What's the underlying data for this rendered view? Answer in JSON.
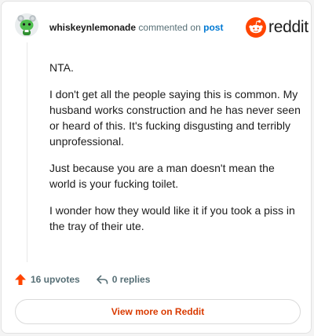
{
  "header": {
    "username": "whiskeynlemonade",
    "action_text": "commented on",
    "post_link": "post"
  },
  "brand": {
    "logo_text": "reddit",
    "accent_color": "#ff4500"
  },
  "comment": {
    "paragraphs": [
      "NTA.",
      "I don't get all the people saying this is common. My husband works construction and he has never seen or heard of this. It's fucking disgusting and terribly unprofessional.",
      "Just because you are a man doesn't mean the world is your fucking toilet.",
      "I wonder how they would like it if you took a piss in the tray of their ute."
    ]
  },
  "actions": {
    "upvotes": "16 upvotes",
    "replies": "0 replies"
  },
  "footer": {
    "view_more": "View more on Reddit"
  },
  "icons": {
    "avatar": "snoo-avatar-icon",
    "logo": "reddit-snoo-icon",
    "upvote": "upvote-arrow-icon",
    "reply": "reply-arrow-icon"
  }
}
